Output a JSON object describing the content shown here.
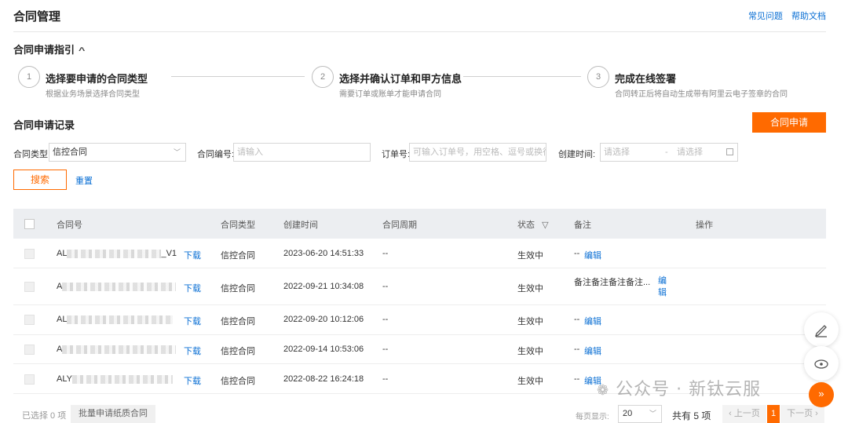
{
  "header": {
    "title": "合同管理",
    "links": [
      "常见问题",
      "帮助文档"
    ]
  },
  "guide": {
    "title": "合同申请指引",
    "steps": [
      {
        "num": "1",
        "title": "选择要申请的合同类型",
        "desc": "根据业务场景选择合同类型"
      },
      {
        "num": "2",
        "title": "选择并确认订单和甲方信息",
        "desc": "需要订单或账单才能申请合同"
      },
      {
        "num": "3",
        "title": "完成在线签署",
        "desc": "合同转正后将自动生成带有阿里云电子签章的合同"
      }
    ]
  },
  "records": {
    "title": "合同申请记录",
    "apply_label": "合同申请"
  },
  "filters": {
    "type_label": "合同类型:",
    "type_value": "信控合同",
    "no_label": "合同编号:",
    "no_placeholder": "请输入",
    "order_label": "订单号:",
    "order_placeholder": "可输入订单号，用空格、逗号或换行",
    "time_label": "创建时间:",
    "time_start_placeholder": "请选择",
    "time_end_placeholder": "请选择",
    "time_sep": "-",
    "search_label": "搜索",
    "reset_label": "重置"
  },
  "table": {
    "columns": [
      "合同号",
      "合同类型",
      "创建时间",
      "合同周期",
      "状态",
      "备注",
      "操作"
    ],
    "download_label": "下载",
    "edit_label": "编辑",
    "rows": [
      {
        "id_visible": "AL",
        "id_suffix": "_V1",
        "type": "信控合同",
        "created": "2023-06-20 14:51:33",
        "period": "--",
        "status": "生效中",
        "note": "--"
      },
      {
        "id_visible": "A",
        "id_suffix": "",
        "type": "信控合同",
        "created": "2022-09-21 10:34:08",
        "period": "--",
        "status": "生效中",
        "note": "备注备注备注备注..."
      },
      {
        "id_visible": "AL",
        "id_suffix": "",
        "type": "信控合同",
        "created": "2022-09-20 10:12:06",
        "period": "--",
        "status": "生效中",
        "note": "--"
      },
      {
        "id_visible": "A",
        "id_suffix": "",
        "type": "信控合同",
        "created": "2022-09-14 10:53:06",
        "period": "--",
        "status": "生效中",
        "note": "--"
      },
      {
        "id_visible": "ALY",
        "id_suffix": "",
        "type": "信控合同",
        "created": "2022-08-22 16:24:18",
        "period": "--",
        "status": "生效中",
        "note": "--"
      }
    ]
  },
  "footer": {
    "selected": "已选择 0 项",
    "batch_label": "批量申请纸质合同",
    "page_size_label": "每页显示:",
    "page_size": "20",
    "total": "共有 5 项",
    "prev": "上一页",
    "current_page": "1",
    "next": "下一页"
  },
  "watermark": "公众号 · 新钛云服",
  "accent_color": "#ff6a00",
  "link_color": "#0a6fd4"
}
